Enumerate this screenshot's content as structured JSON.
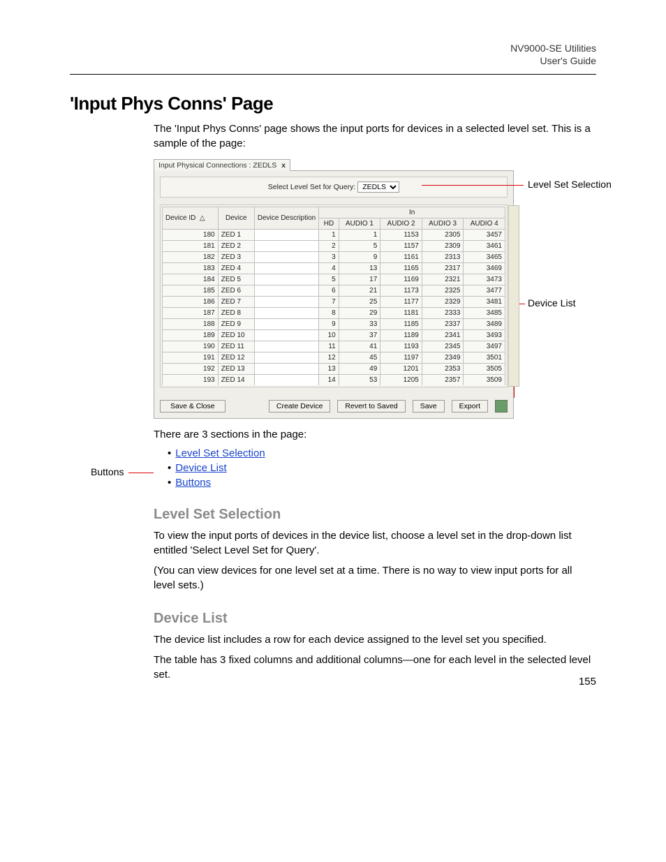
{
  "header": {
    "product": "NV9000-SE Utilities",
    "doc": "User's Guide"
  },
  "title": "'Input Phys Conns' Page",
  "intro": "The 'Input Phys Conns' page shows the input ports for devices in a selected level set. This is a sample of the page:",
  "tab": {
    "label": "Input Physical Connections : ZEDLS",
    "close": "x"
  },
  "level_bar": {
    "label": "Select Level Set for Query:",
    "value": "ZEDLS"
  },
  "callouts": {
    "level_set": "Level Set Selection",
    "device_list": "Device List",
    "buttons": "Buttons"
  },
  "table": {
    "group_header": "In",
    "cols": [
      "Device ID",
      "Device",
      "Device Description",
      "HD",
      "AUDIO 1",
      "AUDIO 2",
      "AUDIO 3",
      "AUDIO 4"
    ],
    "rows": [
      {
        "id": 180,
        "dev": "ZED 1",
        "desc": "",
        "hd": 1,
        "a1": 1,
        "a2": 1153,
        "a3": 2305,
        "a4": 3457
      },
      {
        "id": 181,
        "dev": "ZED 2",
        "desc": "",
        "hd": 2,
        "a1": 5,
        "a2": 1157,
        "a3": 2309,
        "a4": 3461
      },
      {
        "id": 182,
        "dev": "ZED 3",
        "desc": "",
        "hd": 3,
        "a1": 9,
        "a2": 1161,
        "a3": 2313,
        "a4": 3465
      },
      {
        "id": 183,
        "dev": "ZED 4",
        "desc": "",
        "hd": 4,
        "a1": 13,
        "a2": 1165,
        "a3": 2317,
        "a4": 3469
      },
      {
        "id": 184,
        "dev": "ZED 5",
        "desc": "",
        "hd": 5,
        "a1": 17,
        "a2": 1169,
        "a3": 2321,
        "a4": 3473
      },
      {
        "id": 185,
        "dev": "ZED 6",
        "desc": "",
        "hd": 6,
        "a1": 21,
        "a2": 1173,
        "a3": 2325,
        "a4": 3477
      },
      {
        "id": 186,
        "dev": "ZED 7",
        "desc": "",
        "hd": 7,
        "a1": 25,
        "a2": 1177,
        "a3": 2329,
        "a4": 3481
      },
      {
        "id": 187,
        "dev": "ZED 8",
        "desc": "",
        "hd": 8,
        "a1": 29,
        "a2": 1181,
        "a3": 2333,
        "a4": 3485
      },
      {
        "id": 188,
        "dev": "ZED 9",
        "desc": "",
        "hd": 9,
        "a1": 33,
        "a2": 1185,
        "a3": 2337,
        "a4": 3489
      },
      {
        "id": 189,
        "dev": "ZED 10",
        "desc": "",
        "hd": 10,
        "a1": 37,
        "a2": 1189,
        "a3": 2341,
        "a4": 3493
      },
      {
        "id": 190,
        "dev": "ZED 11",
        "desc": "",
        "hd": 11,
        "a1": 41,
        "a2": 1193,
        "a3": 2345,
        "a4": 3497
      },
      {
        "id": 191,
        "dev": "ZED 12",
        "desc": "",
        "hd": 12,
        "a1": 45,
        "a2": 1197,
        "a3": 2349,
        "a4": 3501
      },
      {
        "id": 192,
        "dev": "ZED 13",
        "desc": "",
        "hd": 13,
        "a1": 49,
        "a2": 1201,
        "a3": 2353,
        "a4": 3505
      },
      {
        "id": 193,
        "dev": "ZED 14",
        "desc": "",
        "hd": 14,
        "a1": 53,
        "a2": 1205,
        "a3": 2357,
        "a4": 3509
      }
    ]
  },
  "buttons": {
    "save_close": "Save & Close",
    "create_device": "Create Device",
    "revert": "Revert to Saved",
    "save": "Save",
    "export": "Export"
  },
  "sections_intro": "There are 3 sections in the page:",
  "bullets": {
    "b1": "Level Set Selection",
    "b2": "Device List",
    "b3": "Buttons"
  },
  "sec1": {
    "h": "Level Set Selection",
    "p1": "To view the input ports of devices in the device list, choose a level set in the drop-down list entitled 'Select Level Set for Query'.",
    "p2": "(You can view devices for one level set at a time. There is no way to view input ports for all level sets.)"
  },
  "sec2": {
    "h": "Device List",
    "p1": "The device list includes a row for each device assigned to the level set you specified.",
    "p2": "The table has 3 fixed columns and additional columns—one for each level in the selected level set."
  },
  "page_number": "155"
}
